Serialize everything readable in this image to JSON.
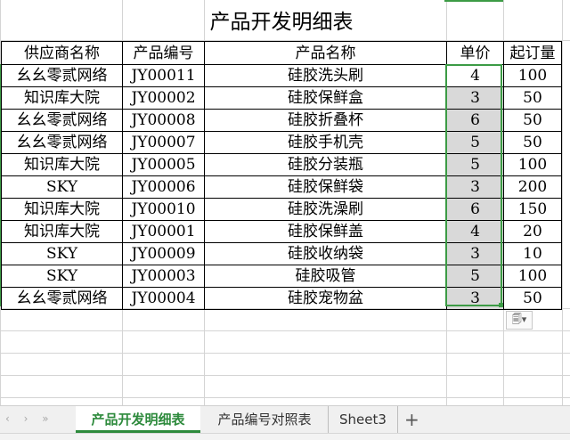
{
  "sheet": {
    "title": "产品开发明细表",
    "headers": [
      "供应商名称",
      "产品编号",
      "产品名称",
      "单价",
      "起订量"
    ],
    "rows": [
      [
        "幺幺零贰网络",
        "JY00011",
        "硅胶洗头刷",
        "4",
        "100"
      ],
      [
        "知识库大院",
        "JY00002",
        "硅胶保鲜盒",
        "3",
        "50"
      ],
      [
        "幺幺零贰网络",
        "JY00008",
        "硅胶折叠杯",
        "6",
        "50"
      ],
      [
        "幺幺零贰网络",
        "JY00007",
        "硅胶手机壳",
        "5",
        "50"
      ],
      [
        "知识库大院",
        "JY00005",
        "硅胶分装瓶",
        "5",
        "100"
      ],
      [
        "SKY",
        "JY00006",
        "硅胶保鲜袋",
        "3",
        "200"
      ],
      [
        "知识库大院",
        "JY00010",
        "硅胶洗澡刷",
        "6",
        "150"
      ],
      [
        "知识库大院",
        "JY00001",
        "硅胶保鲜盖",
        "4",
        "20"
      ],
      [
        "SKY",
        "JY00009",
        "硅胶收纳袋",
        "3",
        "10"
      ],
      [
        "SKY",
        "JY00003",
        "硅胶吸管",
        "5",
        "100"
      ],
      [
        "幺幺零贰网络",
        "JY00004",
        "硅胶宠物盆",
        "3",
        "50"
      ]
    ],
    "selection_color": "#3c9b45",
    "selected_fill": "#d9d9d9"
  },
  "paste_options": {
    "icon": "paste-options-icon",
    "glyph": "🗐▾"
  },
  "tabs": {
    "nav_arrows": "‹ › »",
    "items": [
      "产品开发明细表",
      "产品编号对照表",
      "Sheet3"
    ],
    "active_index": 0,
    "add_label": "+",
    "active_color": "#2d8a3c"
  }
}
